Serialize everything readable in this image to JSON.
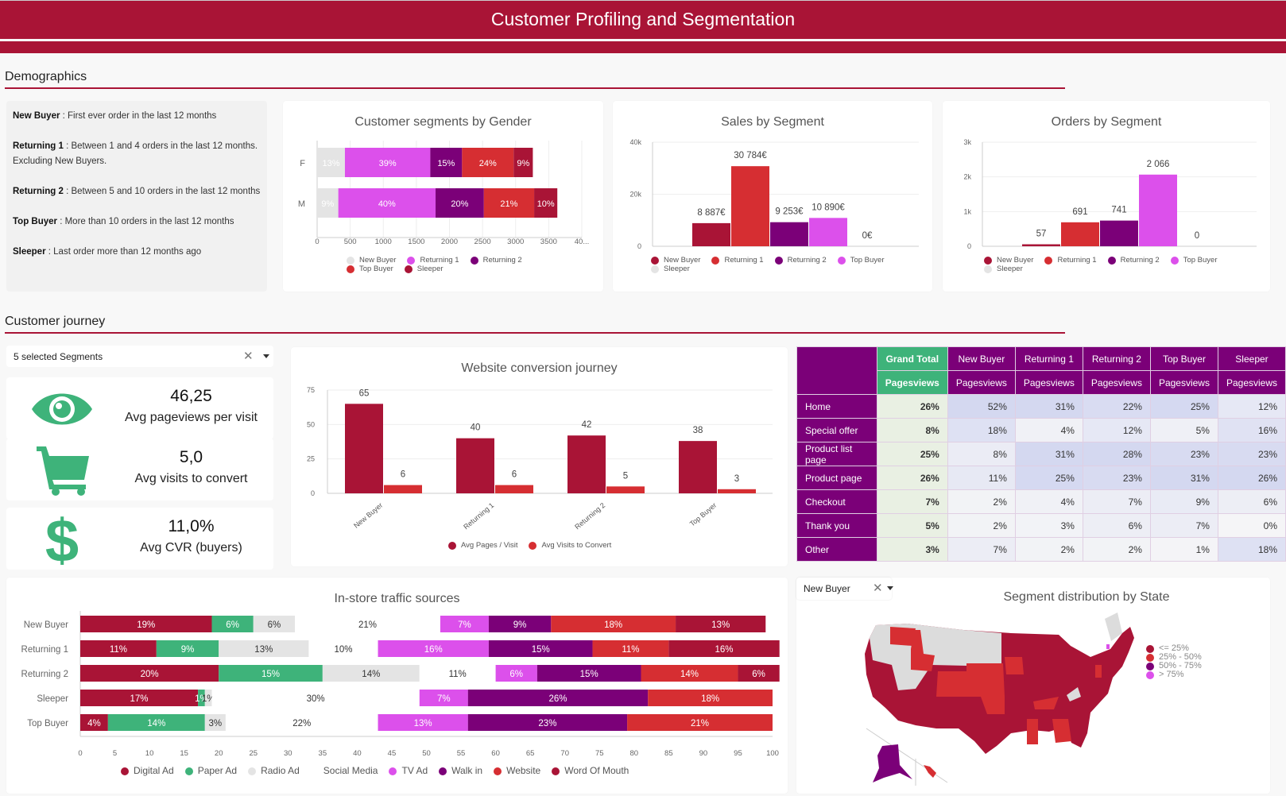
{
  "header": {
    "title": "Customer Profiling and Segmentation"
  },
  "colors": {
    "brand": "#a91436",
    "new_buyer": "#a91436",
    "returning_1": "#d62e32",
    "returning_2": "#7b0078",
    "top_buyer": "#dc50eb",
    "sleeper": "#e4e4e4",
    "green": "#3eb37a"
  },
  "sections": {
    "demographics": "Demographics",
    "journey": "Customer journey"
  },
  "definitions": [
    {
      "term": "New Buyer",
      "text": " : First ever order in the last 12 months"
    },
    {
      "term": "Returning 1",
      "text": " : Between 1 and 4 orders in the last 12 months. Excluding New Buyers."
    },
    {
      "term": "Returning 2",
      "text": " : Between 5 and 10 orders in the last 12 months"
    },
    {
      "term": "Top Buyer",
      "text": " : More than 10 orders in the last 12 months"
    },
    {
      "term": "Sleeper",
      "text": " : Last order more than 12 months ago"
    }
  ],
  "segment_selector": {
    "value": "5 selected Segments"
  },
  "state_selector": {
    "value": "New Buyer"
  },
  "kpis": [
    {
      "icon": "eye-icon",
      "value": "46,25",
      "label": "Avg pageviews per visit"
    },
    {
      "icon": "cart-icon",
      "value": "5,0",
      "label": "Avg visits to convert"
    },
    {
      "icon": "dollar-icon",
      "value": "11,0%",
      "label": "Avg CVR (buyers)"
    }
  ],
  "pivot": {
    "columns": [
      "Grand Total",
      "New Buyer",
      "Returning 1",
      "Returning 2",
      "Top Buyer",
      "Sleeper"
    ],
    "metric": "Pagesviews",
    "rows": [
      {
        "label": "Home",
        "values": [
          "26%",
          "52%",
          "31%",
          "22%",
          "25%",
          "12%"
        ]
      },
      {
        "label": "Special offer",
        "values": [
          "8%",
          "18%",
          "4%",
          "12%",
          "5%",
          "16%"
        ]
      },
      {
        "label": "Product list page",
        "values": [
          "25%",
          "8%",
          "31%",
          "28%",
          "23%",
          "23%"
        ]
      },
      {
        "label": "Product page",
        "values": [
          "26%",
          "11%",
          "25%",
          "23%",
          "31%",
          "26%"
        ]
      },
      {
        "label": "Checkout",
        "values": [
          "7%",
          "2%",
          "4%",
          "7%",
          "9%",
          "6%"
        ]
      },
      {
        "label": "Thank you",
        "values": [
          "5%",
          "2%",
          "3%",
          "6%",
          "7%",
          "0%"
        ]
      },
      {
        "label": "Other",
        "values": [
          "3%",
          "7%",
          "2%",
          "2%",
          "1%",
          "18%"
        ]
      }
    ]
  },
  "map": {
    "title": "Segment distribution by State",
    "legend": [
      {
        "label": "<= 25%",
        "color": "#a91436"
      },
      {
        "label": "25% - 50%",
        "color": "#d62e32"
      },
      {
        "label": "50% - 75%",
        "color": "#7b0078"
      },
      {
        "label": "> 75%",
        "color": "#dc50eb"
      }
    ]
  },
  "chart_data": [
    {
      "id": "gender",
      "type": "bar",
      "orientation": "horizontal-stacked",
      "title": "Customer segments by Gender",
      "categories": [
        "F",
        "M"
      ],
      "xlim": [
        0,
        4000
      ],
      "xticks": [
        "0",
        "500",
        "1000",
        "1500",
        "2000",
        "2500",
        "3000",
        "3500",
        "40..."
      ],
      "series": [
        {
          "name": "New Buyer",
          "color": "#e4e4e4",
          "values": [
            420,
            320
          ],
          "labels": [
            "13%",
            "9%"
          ]
        },
        {
          "name": "Returning 1",
          "color": "#dc50eb",
          "values": [
            1290,
            1470
          ],
          "labels": [
            "39%",
            "40%"
          ]
        },
        {
          "name": "Returning 2",
          "color": "#7b0078",
          "values": [
            480,
            730
          ],
          "labels": [
            "15%",
            "20%"
          ]
        },
        {
          "name": "Top Buyer",
          "color": "#d62e32",
          "values": [
            780,
            760
          ],
          "labels": [
            "24%",
            "21%"
          ]
        },
        {
          "name": "Sleeper",
          "color": "#a91436",
          "values": [
            290,
            350
          ],
          "labels": [
            "9%",
            "10%"
          ]
        }
      ]
    },
    {
      "id": "sales",
      "type": "bar",
      "title": "Sales by Segment",
      "ylim": [
        0,
        40000
      ],
      "yticks": [
        "0",
        "20k",
        "40k"
      ],
      "categories": [
        "New Buyer",
        "Returning 1",
        "Returning 2",
        "Top Buyer",
        "Sleeper"
      ],
      "values": [
        8887,
        30784,
        9253,
        10890,
        0
      ],
      "labels": [
        "8 887€",
        "30 784€",
        "9 253€",
        "10 890€",
        "0€"
      ],
      "colors": [
        "#a91436",
        "#d62e32",
        "#7b0078",
        "#dc50eb",
        "#e4e4e4"
      ]
    },
    {
      "id": "orders",
      "type": "bar",
      "title": "Orders by Segment",
      "ylim": [
        0,
        3000
      ],
      "yticks": [
        "0",
        "1k",
        "2k",
        "3k"
      ],
      "categories": [
        "New Buyer",
        "Returning 1",
        "Returning 2",
        "Top Buyer",
        "Sleeper"
      ],
      "values": [
        57,
        691,
        741,
        2066,
        0
      ],
      "labels": [
        "57",
        "691",
        "741",
        "2 066",
        "0"
      ],
      "colors": [
        "#a91436",
        "#d62e32",
        "#7b0078",
        "#dc50eb",
        "#e4e4e4"
      ]
    },
    {
      "id": "journey",
      "type": "bar",
      "title": "Website conversion journey",
      "ylim": [
        0,
        75
      ],
      "yticks": [
        "0",
        "25",
        "50",
        "75"
      ],
      "categories": [
        "New Buyer",
        "Returning 1",
        "Returning 2",
        "Top Buyer"
      ],
      "series": [
        {
          "name": "Avg Pages / Visit",
          "color": "#a91436",
          "values": [
            65,
            40,
            42,
            38
          ]
        },
        {
          "name": "Avg Visits to Convert",
          "color": "#d62e32",
          "values": [
            6,
            6,
            5,
            3
          ]
        }
      ]
    },
    {
      "id": "instore",
      "type": "bar",
      "orientation": "horizontal-stacked",
      "title": "In-store traffic sources",
      "xlim": [
        0,
        100
      ],
      "xticks": [
        "0",
        "5",
        "10",
        "15",
        "20",
        "25",
        "30",
        "35",
        "40",
        "45",
        "50",
        "55",
        "60",
        "65",
        "70",
        "75",
        "80",
        "85",
        "90",
        "95",
        "100"
      ],
      "categories": [
        "New Buyer",
        "Returning 1",
        "Returning 2",
        "Sleeper",
        "Top Buyer"
      ],
      "series": [
        {
          "name": "Digital Ad",
          "color": "#a91436",
          "values": [
            19,
            11,
            20,
            17,
            4
          ]
        },
        {
          "name": "Paper Ad",
          "color": "#3eb37a",
          "values": [
            6,
            9,
            15,
            1,
            14
          ]
        },
        {
          "name": "Radio Ad",
          "color": "#e4e4e4",
          "values": [
            6,
            13,
            14,
            1,
            3
          ]
        },
        {
          "name": "Social Media",
          "color": "#ffffff",
          "values": [
            21,
            10,
            11,
            30,
            22
          ]
        },
        {
          "name": "TV Ad",
          "color": "#dc50eb",
          "values": [
            7,
            16,
            6,
            7,
            13
          ]
        },
        {
          "name": "Walk in",
          "color": "#7b0078",
          "values": [
            9,
            15,
            15,
            26,
            23
          ]
        },
        {
          "name": "Website",
          "color": "#d62e32",
          "values": [
            18,
            11,
            14,
            18,
            21
          ]
        },
        {
          "name": "Word Of Mouth",
          "color": "#a91436",
          "values": [
            13,
            16,
            6,
            0,
            0
          ]
        }
      ]
    }
  ]
}
